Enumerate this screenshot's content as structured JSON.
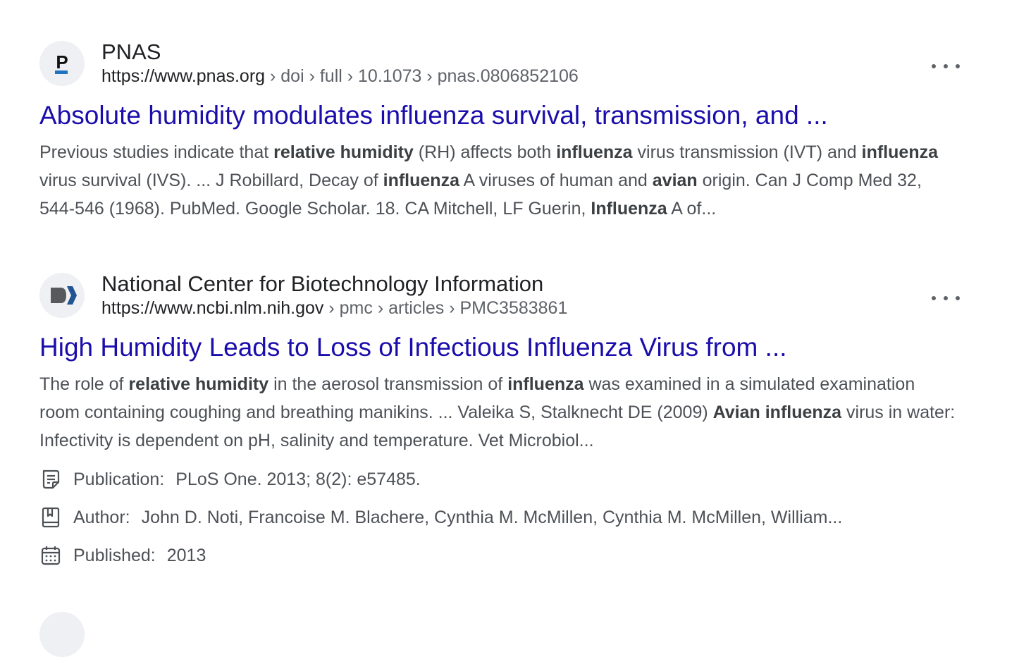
{
  "results": [
    {
      "site_name": "PNAS",
      "url_domain": "https://www.pnas.org",
      "url_path": " › doi › full › 10.1073 › pnas.0806852106",
      "title": "Absolute humidity modulates influenza survival, transmission, and ...",
      "favicon_letter": "P",
      "snippet": [
        {
          "t": "Previous studies indicate that "
        },
        {
          "t": "relative humidity",
          "b": true
        },
        {
          "t": " (RH) affects both "
        },
        {
          "t": "influenza",
          "b": true
        },
        {
          "t": " virus transmission (IVT) and "
        },
        {
          "t": "influenza",
          "b": true
        },
        {
          "t": " virus survival (IVS). ... J Robillard, Decay of "
        },
        {
          "t": "influenza",
          "b": true
        },
        {
          "t": " A viruses of human and "
        },
        {
          "t": "avian",
          "b": true
        },
        {
          "t": " origin. Can J Comp Med 32, 544-546 (1968). PubMed. Google Scholar. 18. CA Mitchell, LF Guerin, "
        },
        {
          "t": "Influenza",
          "b": true
        },
        {
          "t": " A of..."
        }
      ]
    },
    {
      "site_name": "National Center for Biotechnology Information",
      "url_domain": "https://www.ncbi.nlm.nih.gov",
      "url_path": " › pmc › articles › PMC3583861",
      "title": "High Humidity Leads to Loss of Infectious Influenza Virus from ...",
      "snippet": [
        {
          "t": "The role of "
        },
        {
          "t": "relative humidity",
          "b": true
        },
        {
          "t": " in the aerosol transmission of "
        },
        {
          "t": "influenza",
          "b": true
        },
        {
          "t": " was examined in a simulated examination room containing coughing and breathing manikins. ... Valeika S, Stalknecht DE (2009) "
        },
        {
          "t": "Avian influenza",
          "b": true
        },
        {
          "t": " virus in water: Infectivity is dependent on pH, salinity and temperature. Vet Microbiol..."
        }
      ],
      "meta": {
        "publication_label": "Publication:",
        "publication_value": "PLoS One. 2013; 8(2): e57485.",
        "author_label": "Author:",
        "author_value": "John D. Noti, Francoise M. Blachere, Cynthia M. McMillen, Cynthia M. McMillen, William...",
        "published_label": "Published:",
        "published_value": "2013"
      }
    }
  ],
  "icons": {
    "more": "more-options-icon",
    "publication": "document-icon",
    "author": "book-icon",
    "published": "calendar-icon"
  },
  "colors": {
    "link": "#1a0dab",
    "ncbi_dark": "#58595b",
    "ncbi_blue": "#205493",
    "pnas_blue": "#1e73be"
  }
}
